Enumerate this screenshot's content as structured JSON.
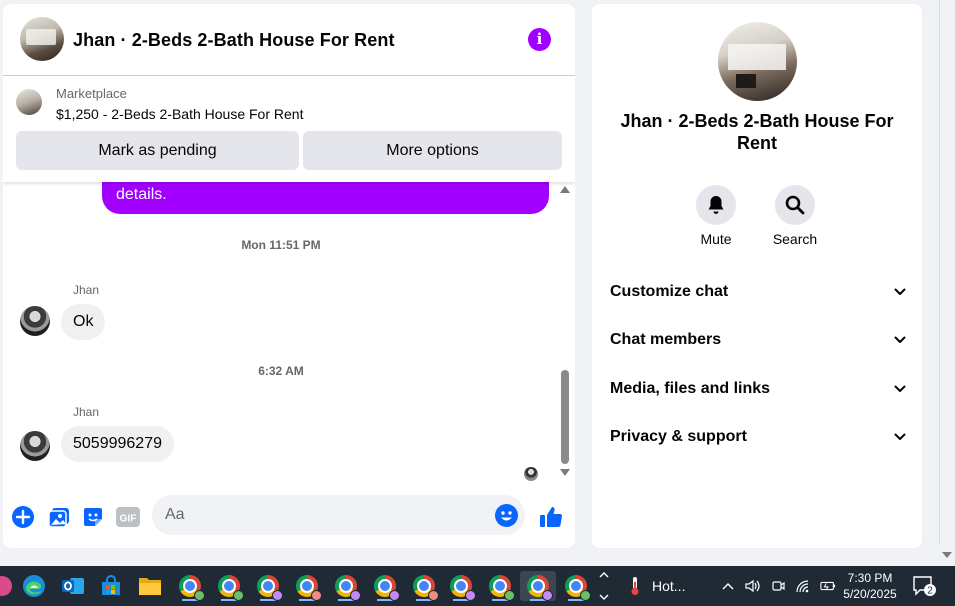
{
  "chat": {
    "title": "Jhan · 2-Beds 2-Bath House For Rent",
    "marketplace": {
      "label": "Marketplace",
      "item": "$1,250 - 2-Beds 2-Bath House For Rent"
    },
    "buttons": {
      "pending": "Mark as pending",
      "more": "More options"
    },
    "messages": {
      "partial_bubble": "details.",
      "ts1": "Mon 11:51 PM",
      "sender1": "Jhan",
      "msg1": "Ok",
      "ts2": "6:32 AM",
      "sender2": "Jhan",
      "msg2": "5059996279"
    },
    "composer": {
      "placeholder": "Aa"
    },
    "colors": {
      "accent": "#a100ff",
      "link": "#0866ff"
    }
  },
  "details": {
    "title": "Jhan · 2-Beds 2-Bath House For Rent",
    "actions": {
      "mute": "Mute",
      "search": "Search"
    },
    "sections": {
      "customize": "Customize chat",
      "members": "Chat members",
      "media": "Media, files and links",
      "privacy": "Privacy & support"
    }
  },
  "taskbar": {
    "weather": "Hot...",
    "time": "7:30 PM",
    "date": "5/20/2025",
    "notifications": "2",
    "icons": [
      "edge-icon",
      "outlook-icon",
      "store-icon",
      "file-explorer-icon",
      "chrome-icon"
    ]
  }
}
